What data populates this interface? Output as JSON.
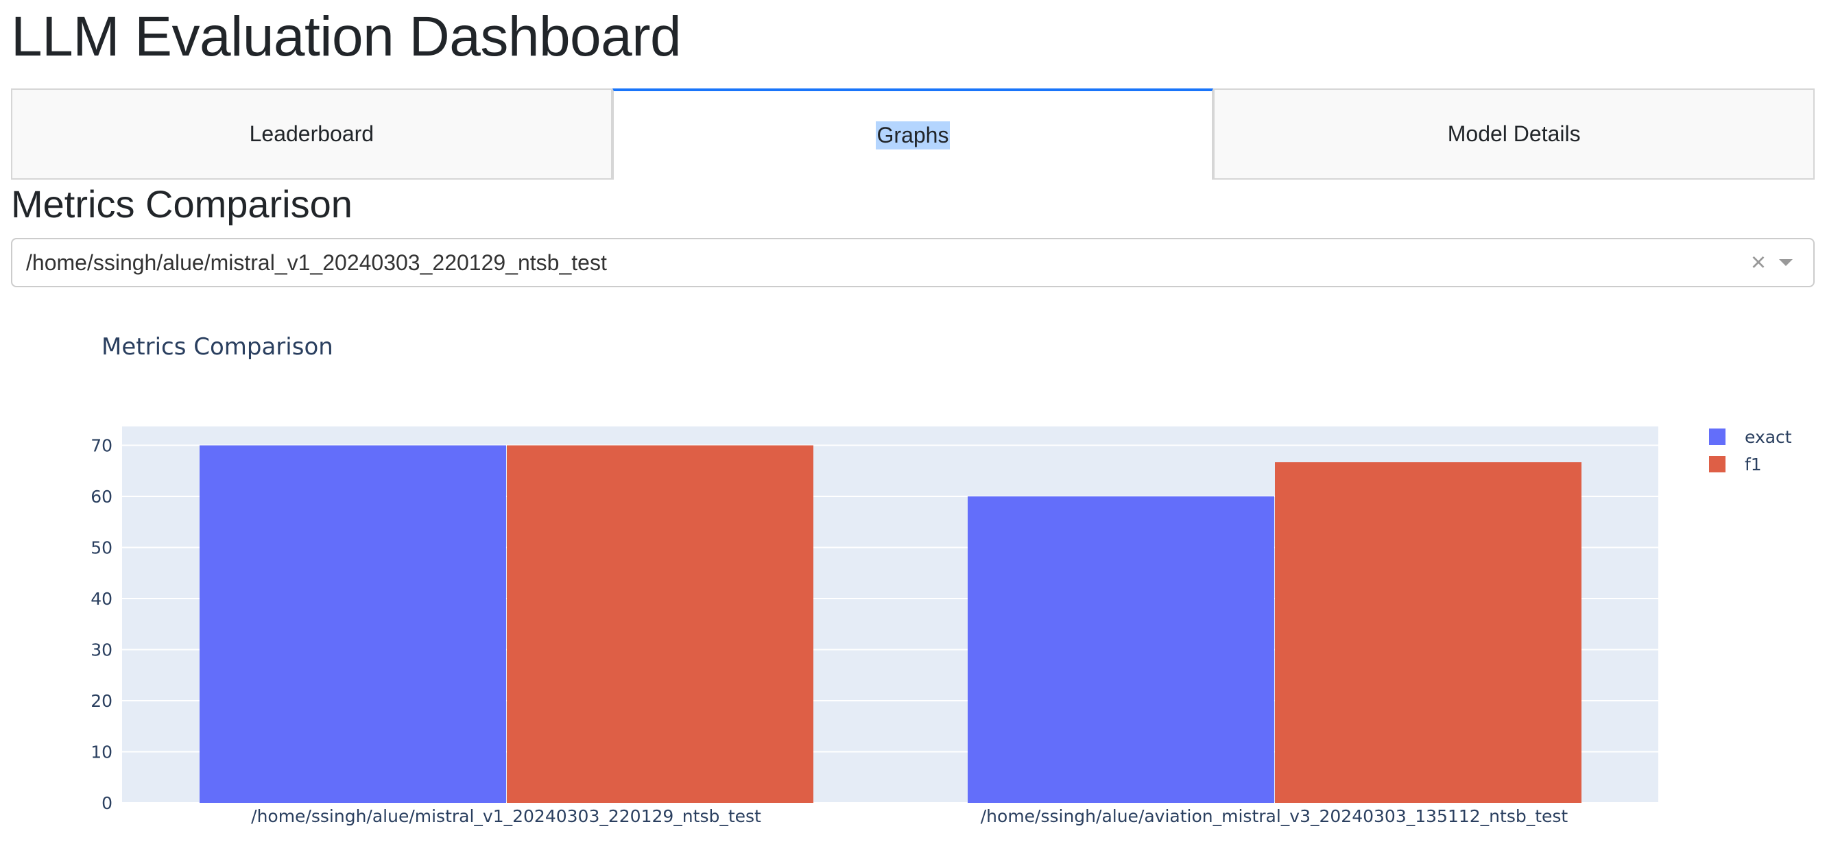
{
  "app": {
    "title": "LLM Evaluation Dashboard"
  },
  "tabs": [
    {
      "label": "Leaderboard",
      "selected": false
    },
    {
      "label": "Graphs",
      "selected": true
    },
    {
      "label": "Model Details",
      "selected": false
    }
  ],
  "section": {
    "title": "Metrics Comparison"
  },
  "model_select": {
    "value": "/home/ssingh/alue/mistral_v1_20240303_220129_ntsb_test",
    "clear_icon": "×",
    "arrow_icon": "chevron-down-icon"
  },
  "chart_data": {
    "type": "bar",
    "title": "Metrics Comparison",
    "categories": [
      "/home/ssingh/alue/mistral_v1_20240303_220129_ntsb_test",
      "/home/ssingh/alue/aviation_mistral_v3_20240303_135112_ntsb_test"
    ],
    "series": [
      {
        "name": "exact",
        "color": "#636efa",
        "values": [
          70,
          60
        ]
      },
      {
        "name": "f1",
        "color": "#de5f46",
        "values": [
          70,
          66.7
        ]
      }
    ],
    "ylim": [
      0,
      73.7
    ],
    "yticks": [
      0,
      10,
      20,
      30,
      40,
      50,
      60,
      70
    ],
    "grid": true,
    "legend": "top-right",
    "plot_bgcolor": "#e5ecf6"
  }
}
